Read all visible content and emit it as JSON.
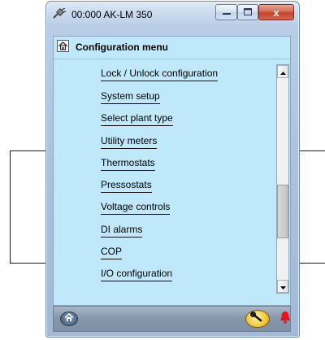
{
  "window": {
    "title": "00:000 AK-LM 350",
    "close_glyph": "x",
    "icons": {
      "app": "plug-icon",
      "minimize": "minimize-icon",
      "maximize": "maximize-icon",
      "close": "close-icon"
    }
  },
  "panel": {
    "title": "Configuration menu",
    "title_icon": "home-icon",
    "menu_items": [
      "Lock / Unlock configuration",
      "System setup",
      "Select plant type",
      "Utility meters",
      "Thermostats",
      "Pressostats",
      "Voltage controls",
      "DI alarms",
      "COP",
      "I/O configuration"
    ]
  },
  "scrollbar": {
    "up_icon": "scroll-up-arrow-icon",
    "down_icon": "scroll-down-arrow-icon",
    "position": 0.72
  },
  "footer": {
    "home_icon": "home-icon",
    "tools_icon": "wrench-icon",
    "alarm_icon": "alarm-bell-icon",
    "alarm_color": "#e8141c"
  },
  "colors": {
    "panel_background": "#bfe8fb",
    "window_frame": "#b9cde6"
  }
}
